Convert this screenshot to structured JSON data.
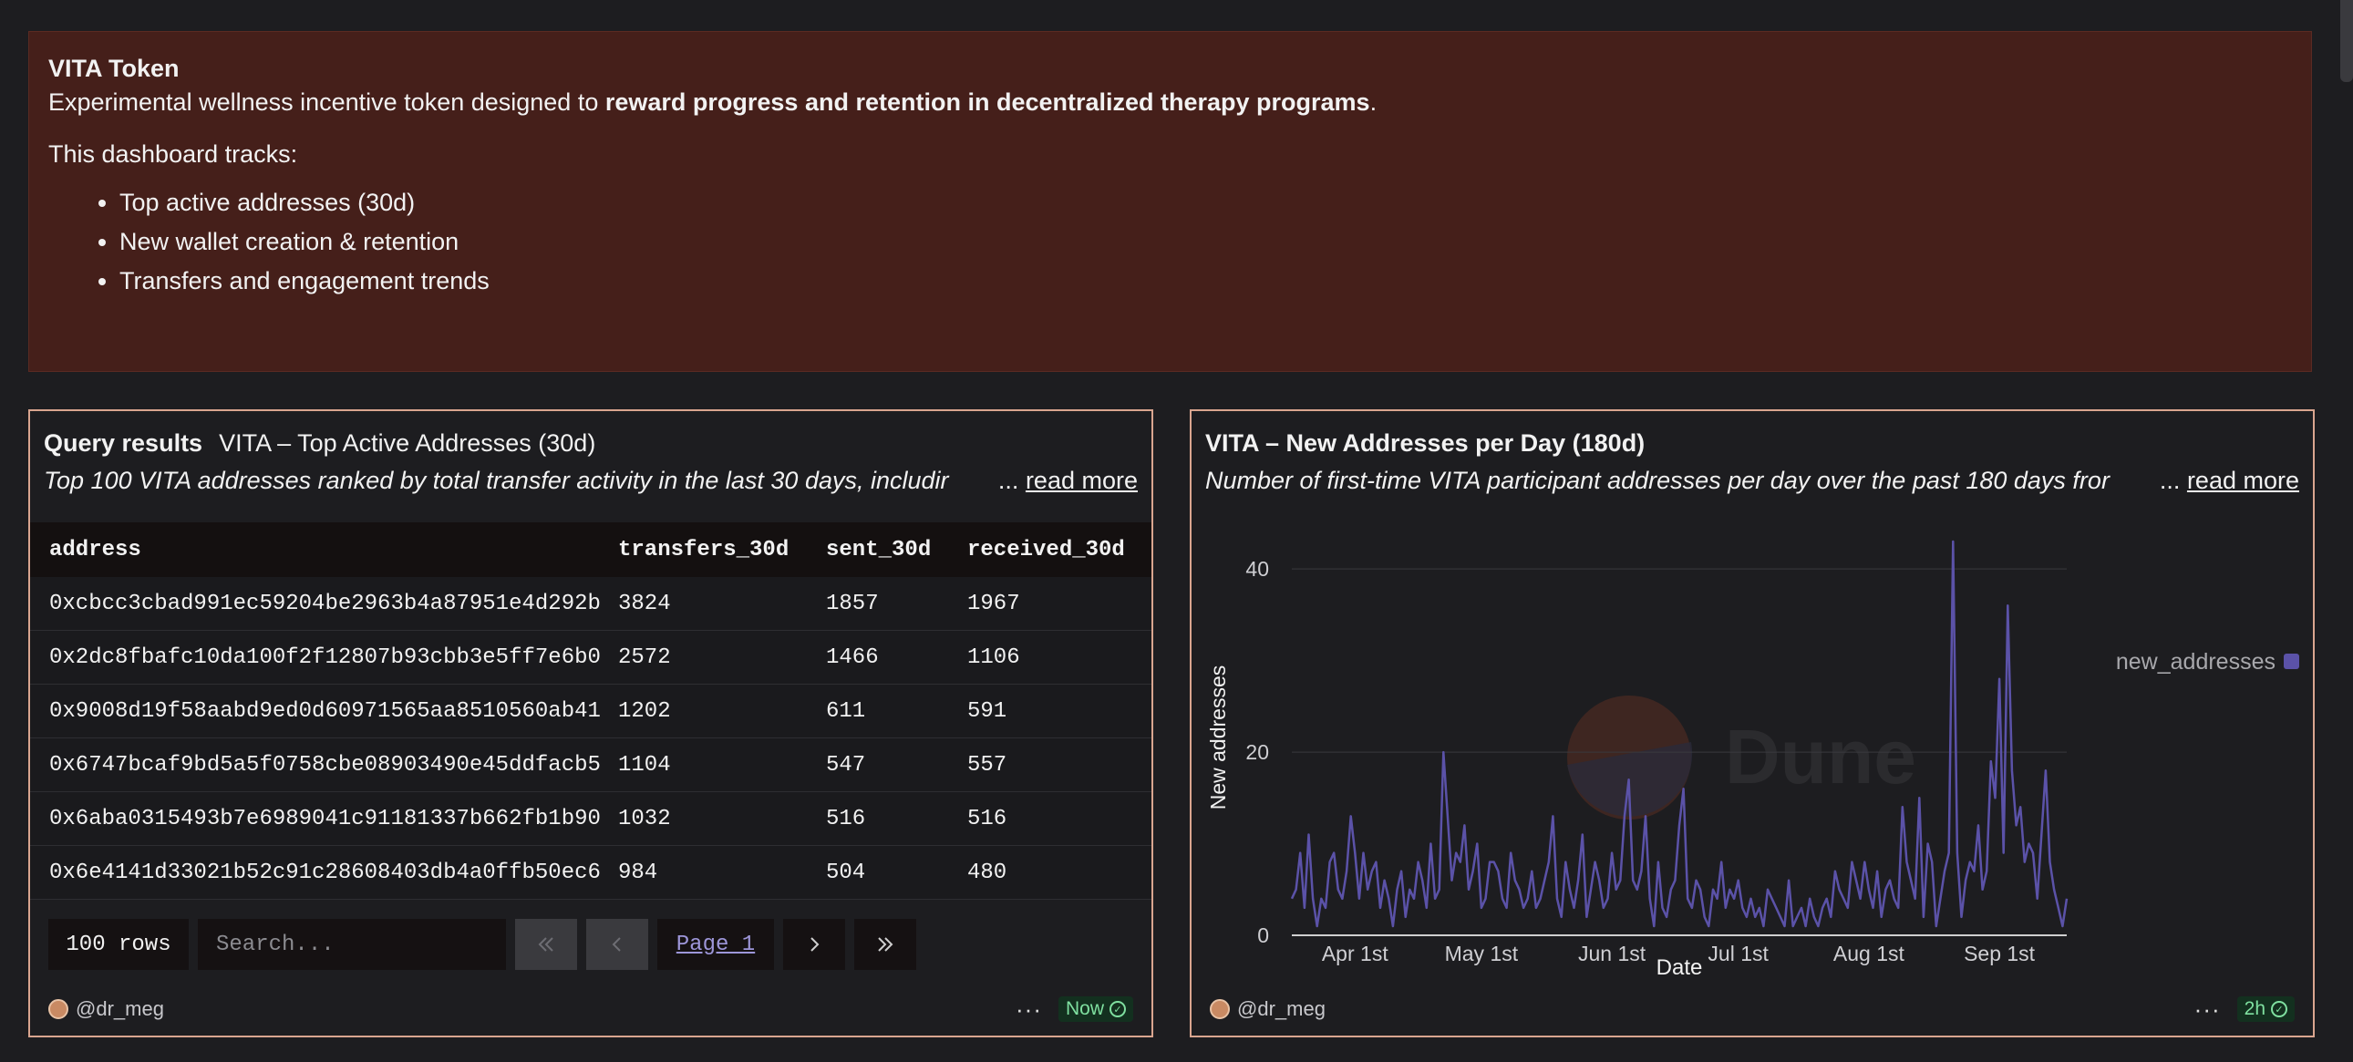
{
  "banner": {
    "title": "VITA Token",
    "desc_plain": "Experimental wellness incentive token designed to ",
    "desc_bold": "reward progress and retention in decentralized therapy programs",
    "desc_end": ".",
    "tracks_label": "This dashboard tracks:",
    "items": [
      "Top active addresses (30d)",
      "New wallet creation & retention",
      "Transfers and engagement trends"
    ]
  },
  "table_panel": {
    "prefix": "Query results",
    "title": "VITA – Top Active Addresses (30d)",
    "description": "Top 100 VITA addresses ranked by total transfer activity in the last 30 days, includir",
    "ellipsis": "...",
    "read_more": "read more",
    "columns": [
      "address",
      "transfers_30d",
      "sent_30d",
      "received_30d"
    ],
    "rows": [
      [
        "0xcbcc3cbad991ec59204be2963b4a87951e4d292b",
        "3824",
        "1857",
        "1967"
      ],
      [
        "0x2dc8fbafc10da100f2f12807b93cbb3e5ff7e6b0",
        "2572",
        "1466",
        "1106"
      ],
      [
        "0x9008d19f58aabd9ed0d60971565aa8510560ab41",
        "1202",
        "611",
        "591"
      ],
      [
        "0x6747bcaf9bd5a5f0758cbe08903490e45ddfacb5",
        "1104",
        "547",
        "557"
      ],
      [
        "0x6aba0315493b7e6989041c91181337b662fb1b90",
        "1032",
        "516",
        "516"
      ],
      [
        "0x6e4141d33021b52c91c28608403db4a0ffb50ec6",
        "984",
        "504",
        "480"
      ]
    ],
    "rows_count": "100 rows",
    "search_placeholder": "Search...",
    "page_label": "Page 1",
    "author": "@dr_meg",
    "more": "···",
    "status": "Now"
  },
  "chart_panel": {
    "title": "VITA – New Addresses per Day (180d)",
    "description": "Number of first-time VITA participant addresses per day over the past 180 days fror",
    "ellipsis": "...",
    "read_more": "read more",
    "author": "@dr_meg",
    "more": "···",
    "status": "2h",
    "watermark": "Dune"
  },
  "chart_data": {
    "type": "line",
    "xlabel": "Date",
    "ylabel": "New addresses",
    "ylim": [
      0,
      43
    ],
    "yticks": [
      0,
      20,
      40
    ],
    "x_tick_labels": [
      "Apr 1st",
      "May 1st",
      "Jun 1st",
      "Jul 1st",
      "Aug 1st",
      "Sep 1st"
    ],
    "x_tick_day_index": [
      15,
      45,
      76,
      106,
      137,
      168
    ],
    "x_start": "Mar 17",
    "legend_position": "right",
    "grid": true,
    "series": [
      {
        "name": "new_addresses",
        "color": "#5b52a8",
        "values": [
          4,
          5,
          9,
          3,
          11,
          4,
          1,
          4,
          3,
          8,
          9,
          5,
          4,
          7,
          13,
          9,
          4,
          9,
          5,
          7,
          8,
          3,
          6,
          4,
          1,
          5,
          7,
          2,
          5,
          4,
          8,
          6,
          3,
          10,
          4,
          5,
          20,
          13,
          6,
          9,
          8,
          12,
          5,
          7,
          10,
          3,
          4,
          8,
          8,
          7,
          4,
          3,
          9,
          6,
          5,
          3,
          4,
          7,
          3,
          4,
          6,
          8,
          13,
          4,
          2,
          8,
          5,
          3,
          6,
          11,
          2,
          5,
          8,
          6,
          3,
          4,
          9,
          5,
          6,
          13,
          17,
          6,
          5,
          7,
          13,
          4,
          1,
          8,
          3,
          2,
          5,
          6,
          12,
          16,
          4,
          3,
          6,
          5,
          2,
          1,
          5,
          4,
          8,
          3,
          5,
          4,
          6,
          3,
          2,
          4,
          2,
          3,
          1,
          5,
          4,
          3,
          2,
          1,
          6,
          1,
          2,
          3,
          1,
          4,
          2,
          1,
          3,
          4,
          2,
          7,
          5,
          4,
          3,
          8,
          6,
          4,
          8,
          5,
          3,
          7,
          2,
          5,
          6,
          4,
          3,
          14,
          8,
          6,
          4,
          15,
          2,
          10,
          8,
          1,
          4,
          7,
          9,
          43,
          9,
          2,
          6,
          8,
          7,
          12,
          5,
          7,
          19,
          15,
          28,
          9,
          36,
          18,
          12,
          14,
          8,
          10,
          9,
          4,
          11,
          18,
          8,
          5,
          3,
          1,
          4
        ]
      }
    ]
  }
}
